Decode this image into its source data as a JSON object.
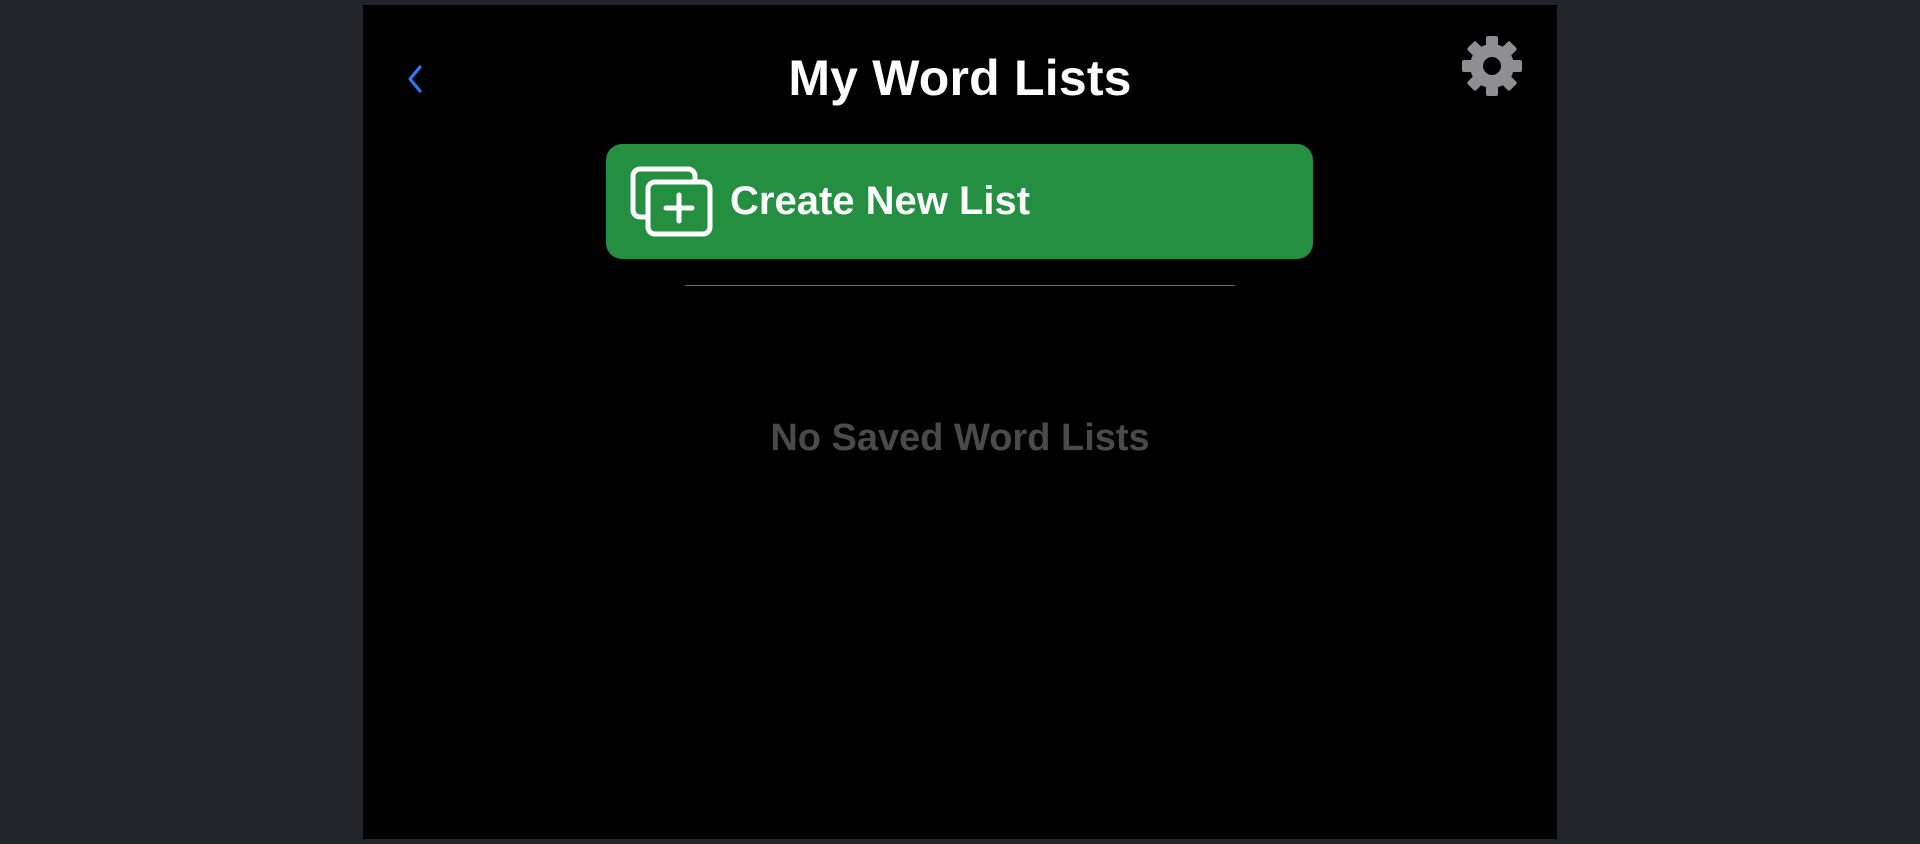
{
  "header": {
    "title": "My Word Lists",
    "back_icon": "chevron-left-icon",
    "settings_icon": "gear-icon"
  },
  "actions": {
    "create_label": "Create New List",
    "create_icon": "add-stack-icon"
  },
  "content": {
    "empty_message": "No Saved Word Lists"
  },
  "colors": {
    "background_outer": "#222429",
    "screen_background": "#000000",
    "accent_green": "#248e41",
    "back_blue": "#2f7bf5",
    "gear_gray": "#8e8e93",
    "empty_text_gray": "#4a4a4a"
  }
}
